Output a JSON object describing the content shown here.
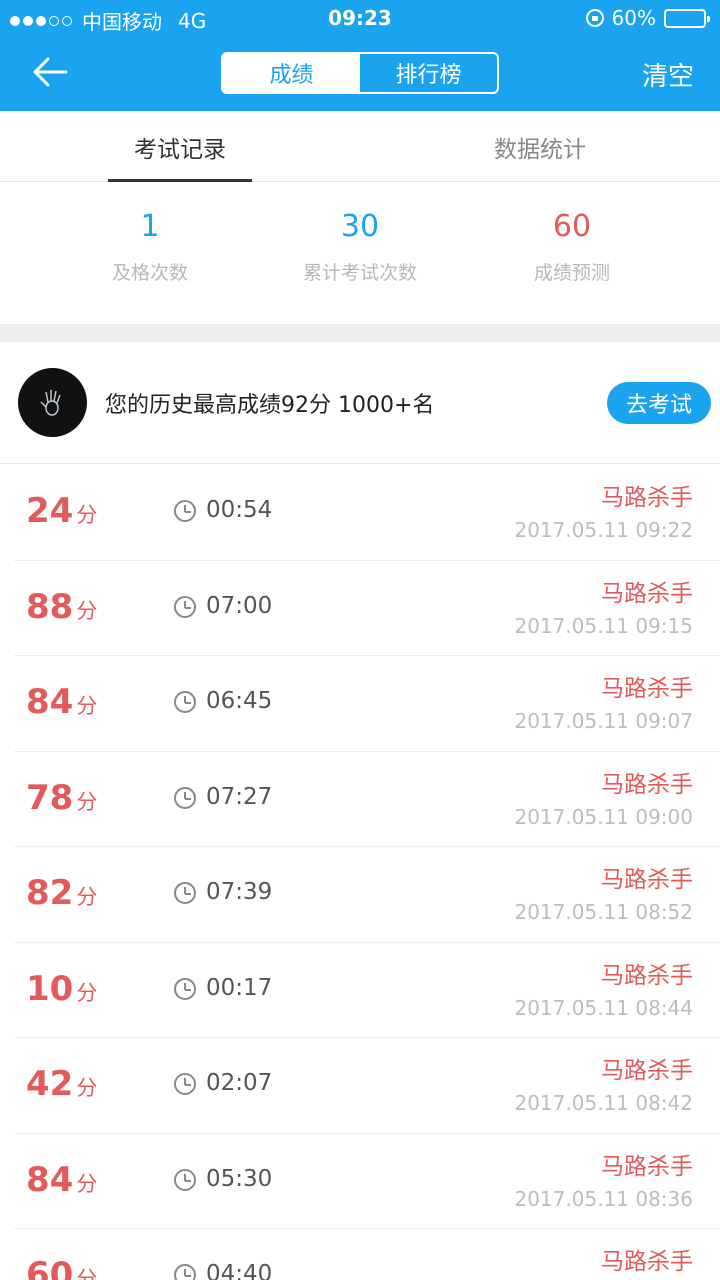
{
  "status_bar": {
    "carrier": "中国移动",
    "network": "4G",
    "time": "09:23",
    "battery_text": "60%",
    "battery_level": 0.6
  },
  "header": {
    "segments": [
      "成绩",
      "排行榜"
    ],
    "active_segment": "成绩",
    "clear_label": "清空",
    "back_icon": "arrow-left-icon"
  },
  "tabs": [
    {
      "label": "考试记录",
      "active": true
    },
    {
      "label": "数据统计",
      "active": false
    }
  ],
  "stats": [
    {
      "value": "1",
      "label": "及格次数",
      "color": "#1aa4f0"
    },
    {
      "value": "30",
      "label": "累计考试次数",
      "color": "#1aa4f0"
    },
    {
      "value": "60",
      "label": "成绩预测",
      "color": "#e35a5a"
    }
  ],
  "best": {
    "text": "您的历史最高成绩92分 1000+名",
    "button_label": "去考试"
  },
  "score_unit": "分",
  "records": [
    {
      "score": "24",
      "duration": "00:54",
      "title": "马路杀手",
      "datetime": "2017.05.11 09:22"
    },
    {
      "score": "88",
      "duration": "07:00",
      "title": "马路杀手",
      "datetime": "2017.05.11 09:15"
    },
    {
      "score": "84",
      "duration": "06:45",
      "title": "马路杀手",
      "datetime": "2017.05.11 09:07"
    },
    {
      "score": "78",
      "duration": "07:27",
      "title": "马路杀手",
      "datetime": "2017.05.11 09:00"
    },
    {
      "score": "82",
      "duration": "07:39",
      "title": "马路杀手",
      "datetime": "2017.05.11 08:52"
    },
    {
      "score": "10",
      "duration": "00:17",
      "title": "马路杀手",
      "datetime": "2017.05.11 08:44"
    },
    {
      "score": "42",
      "duration": "02:07",
      "title": "马路杀手",
      "datetime": "2017.05.11 08:42"
    },
    {
      "score": "84",
      "duration": "05:30",
      "title": "马路杀手",
      "datetime": "2017.05.11 08:36"
    },
    {
      "score": "60",
      "duration": "04:40",
      "title": "马路杀手",
      "datetime": ""
    }
  ]
}
